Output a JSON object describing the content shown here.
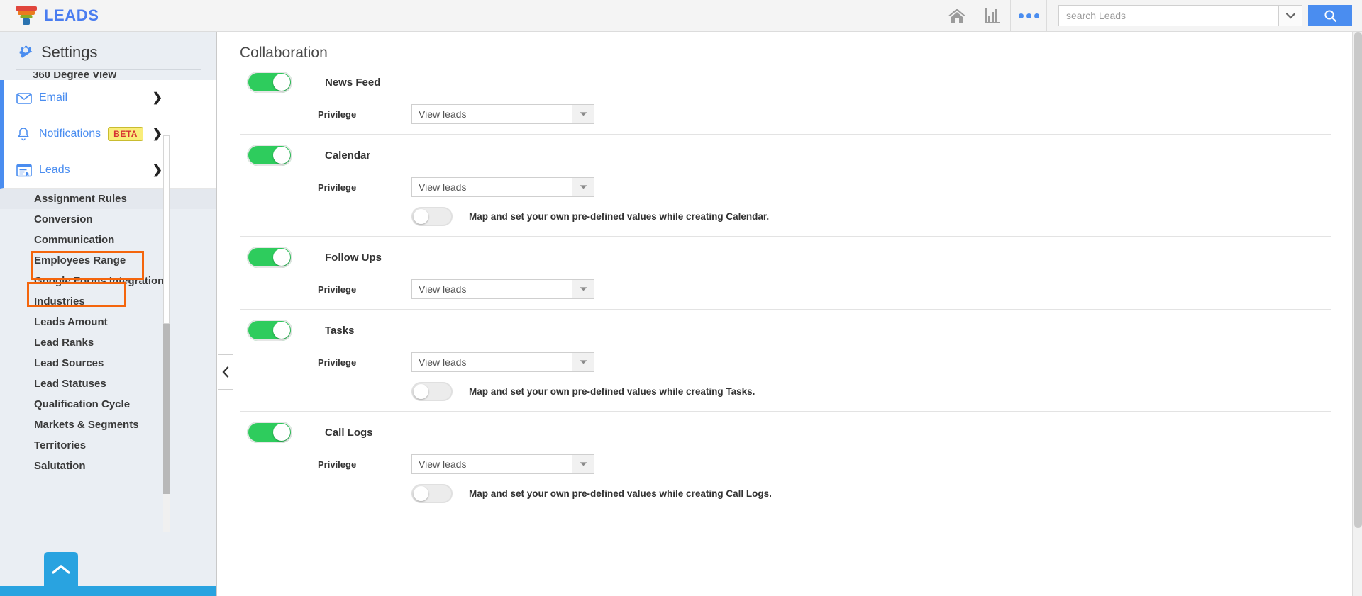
{
  "topbar": {
    "brand": "LEADS",
    "logo_icon": "funnel-logo-icon",
    "home_icon": "home-icon",
    "reports_icon": "bar-chart-icon",
    "more_icon": "three-dots-icon",
    "search_placeholder": "search Leads",
    "search_value": "",
    "search_dropdown_icon": "chevron-down-icon",
    "search_button_icon": "search-icon",
    "accent_blue": "#4a8df0"
  },
  "sidebar": {
    "title": "Settings",
    "gear_icon": "gear-icon",
    "cut_off_item": "360 Degree View",
    "groups": [
      {
        "label": "Email",
        "icon": "envelope-icon",
        "chevron": "chevron-right-icon",
        "badge": ""
      },
      {
        "label": "Notifications",
        "icon": "bell-icon",
        "chevron": "chevron-right-icon",
        "badge": "BETA"
      },
      {
        "label": "Leads",
        "icon": "leads-card-icon",
        "chevron": "chevron-down-icon",
        "badge": ""
      }
    ],
    "sub_items": [
      "Assignment Rules",
      "Conversion",
      "Communication",
      "Employees Range",
      "Google Forms Integration",
      "Industries",
      "Leads Amount",
      "Lead Ranks",
      "Lead Sources",
      "Lead Statuses",
      "Qualification Cycle",
      "Markets & Segments",
      "Territories",
      "Salutation"
    ],
    "active_sub_item": "Assignment Rules",
    "highlight_color": "#f4650c",
    "scroll_top_icon": "chevron-up-icon"
  },
  "main": {
    "collapse_icon": "chevron-left-icon",
    "page_title": "Collaboration",
    "privilege_label": "Privilege",
    "select_arrow_icon": "caret-down-icon",
    "sections": [
      {
        "name": "News Feed",
        "enabled": true,
        "privilege_value": "View leads",
        "map_toggle": null,
        "map_text": ""
      },
      {
        "name": "Calendar",
        "enabled": true,
        "privilege_value": "View leads",
        "map_toggle": false,
        "map_text": "Map and set your own pre-defined values while creating Calendar."
      },
      {
        "name": "Follow Ups",
        "enabled": true,
        "privilege_value": "View leads",
        "map_toggle": null,
        "map_text": ""
      },
      {
        "name": "Tasks",
        "enabled": true,
        "privilege_value": "View leads",
        "map_toggle": false,
        "map_text": "Map and set your own pre-defined values while creating Tasks."
      },
      {
        "name": "Call Logs",
        "enabled": true,
        "privilege_value": "View leads",
        "map_toggle": false,
        "map_text": "Map and set your own pre-defined values while creating Call Logs."
      }
    ]
  }
}
